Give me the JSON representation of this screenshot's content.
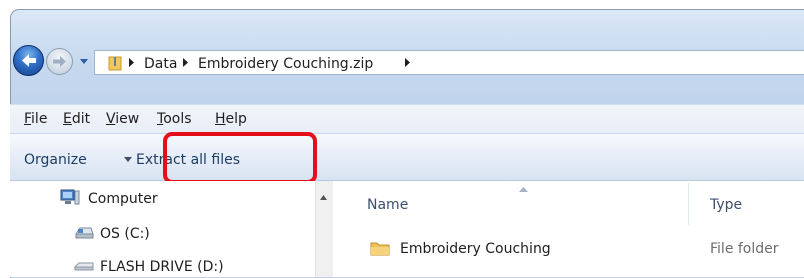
{
  "address_bar": {
    "crumbs": [
      "Data",
      "Embroidery Couching.zip"
    ]
  },
  "menu": {
    "items": [
      {
        "first": "F",
        "rest": "ile"
      },
      {
        "first": "E",
        "rest": "dit"
      },
      {
        "first": "V",
        "rest": "iew"
      },
      {
        "first": "T",
        "rest": "ools"
      },
      {
        "first": "H",
        "rest": "elp"
      }
    ]
  },
  "toolbar": {
    "organize_label": "Organize",
    "extract_label": "Extract all files"
  },
  "nav_pane": {
    "items": [
      {
        "label": "Computer",
        "icon": "computer-icon"
      },
      {
        "label": "OS (C:)",
        "icon": "drive-icon"
      },
      {
        "label": "FLASH DRIVE (D:)",
        "icon": "usb-drive-icon"
      }
    ]
  },
  "file_list": {
    "columns": [
      "Name",
      "Type"
    ],
    "rows": [
      {
        "name": "Embroidery Couching",
        "type": "File folder",
        "icon": "folder-icon"
      }
    ]
  },
  "colors": {
    "highlight": "#e3101b",
    "title_gradient": "#c6d9ef",
    "nav_back": "#2f6fc6"
  }
}
